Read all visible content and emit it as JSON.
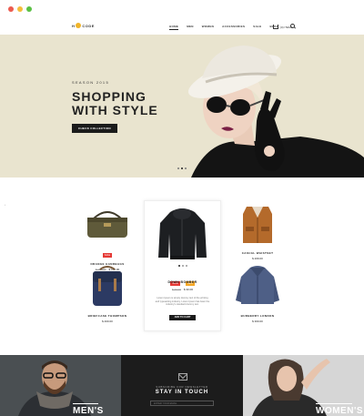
{
  "header": {
    "logo_left": "H",
    "logo_right": "CODE",
    "nav": [
      "HOME",
      "MEN",
      "WOMEN",
      "ACCESSORIES",
      "SALE",
      "BLOG"
    ],
    "cart": "(0) ITEMS"
  },
  "hero": {
    "season": "SEASON 2015",
    "headline_line1": "SHOPPING",
    "headline_line2": "WITH STYLE",
    "cta": "CHECK COLLECTION"
  },
  "products": {
    "items": [
      {
        "name": "ORANGE HANDBAGS",
        "old_price": "$ 150.00",
        "price": "$ 100.00",
        "tag": "SALE"
      },
      {
        "name": "CASUAL WAISTSET",
        "price": "$ 209.00"
      },
      {
        "name": "BRIEFCASE THOMPSON",
        "price": "$ 400.00"
      },
      {
        "name": "BURBERRY LONDON",
        "price": "$ 300.00"
      }
    ],
    "feature": {
      "tags": [
        "SALE",
        "NEW"
      ],
      "name": "DOWN BOMBER",
      "old_price": "$ 40.00",
      "price": "$ 30.00",
      "description": "Lorem Ipsum is simply dummy text of the printing and typesetting industry. Lorem Ipsum has been the industry's standard dummy text.",
      "add": "ADD TO CART"
    }
  },
  "bottom": {
    "left_label": "MEN'S",
    "newsletter_sub": "SUBSCRIBE FOR NEWSLETTER",
    "newsletter_title": "STAY IN TOUCH",
    "email_placeholder": "ENTER YOUR EMAIL",
    "right_label": "WOMEN'S"
  },
  "colors": {
    "accent": "#f0b429",
    "dark": "#1b1b1b",
    "hero_bg": "#e9e4cf",
    "sale": "#e53935",
    "new": "#f5a623"
  }
}
